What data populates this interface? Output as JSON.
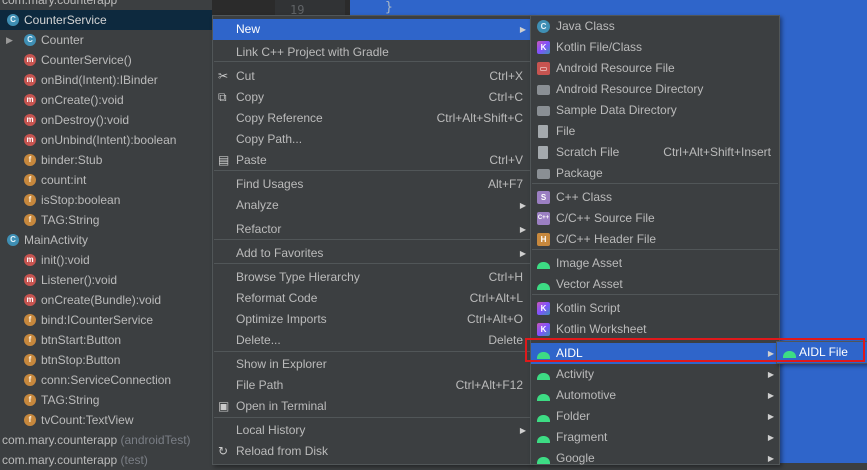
{
  "editor": {
    "line_number": "19",
    "brace": "}"
  },
  "tree": {
    "top_package": "com.mary.counterapp",
    "rows": [
      {
        "label": "CounterService",
        "icon": "class-icon",
        "kind": "c"
      },
      {
        "label": "Counter",
        "icon": "class-icon",
        "kind": "c"
      },
      {
        "label": "CounterService()",
        "icon": "method-icon",
        "kind": "m"
      },
      {
        "label": "onBind(Intent):IBinder",
        "icon": "method-icon",
        "kind": "m"
      },
      {
        "label": "onCreate():void",
        "icon": "method-icon",
        "kind": "m"
      },
      {
        "label": "onDestroy():void",
        "icon": "method-icon",
        "kind": "m"
      },
      {
        "label": "onUnbind(Intent):boolean",
        "icon": "method-icon",
        "kind": "m"
      },
      {
        "label": "binder:Stub",
        "icon": "field-icon",
        "kind": "f"
      },
      {
        "label": "count:int",
        "icon": "field-icon",
        "kind": "f"
      },
      {
        "label": "isStop:boolean",
        "icon": "field-icon",
        "kind": "f"
      },
      {
        "label": "TAG:String",
        "icon": "field-icon",
        "kind": "f"
      },
      {
        "label": "MainActivity",
        "icon": "class-icon",
        "kind": "c"
      },
      {
        "label": "init():void",
        "icon": "method-icon",
        "kind": "m"
      },
      {
        "label": "Listener():void",
        "icon": "method-icon",
        "kind": "m"
      },
      {
        "label": "onCreate(Bundle):void",
        "icon": "method-icon",
        "kind": "m"
      },
      {
        "label": "bind:ICounterService",
        "icon": "field-icon",
        "kind": "f"
      },
      {
        "label": "btnStart:Button",
        "icon": "field-icon",
        "kind": "f"
      },
      {
        "label": "btnStop:Button",
        "icon": "field-icon",
        "kind": "f"
      },
      {
        "label": "conn:ServiceConnection",
        "icon": "field-icon",
        "kind": "f"
      },
      {
        "label": "TAG:String",
        "icon": "field-icon",
        "kind": "f"
      },
      {
        "label": "tvCount:TextView",
        "icon": "field-icon",
        "kind": "f"
      }
    ],
    "bottom1_pkg": "com.mary.counterapp",
    "bottom1_suffix": "(androidTest)",
    "bottom2_pkg": "com.mary.counterapp",
    "bottom2_suffix": "(test)"
  },
  "menu": {
    "items": [
      {
        "label": "New",
        "shortcut": "",
        "submenu": true
      },
      {
        "label": "Link C++ Project with Gradle",
        "shortcut": ""
      },
      {
        "label": "Cut",
        "shortcut": "Ctrl+X",
        "icon": "scissors-icon"
      },
      {
        "label": "Copy",
        "shortcut": "Ctrl+C",
        "icon": "copy-icon"
      },
      {
        "label": "Copy Reference",
        "shortcut": "Ctrl+Alt+Shift+C"
      },
      {
        "label": "Copy Path...",
        "shortcut": ""
      },
      {
        "label": "Paste",
        "shortcut": "Ctrl+V",
        "icon": "paste-icon"
      },
      {
        "label": "Find Usages",
        "shortcut": "Alt+F7"
      },
      {
        "label": "Analyze",
        "shortcut": "",
        "submenu": true
      },
      {
        "label": "Refactor",
        "shortcut": "",
        "submenu": true
      },
      {
        "label": "Add to Favorites",
        "shortcut": "",
        "submenu": true
      },
      {
        "label": "Browse Type Hierarchy",
        "shortcut": "Ctrl+H"
      },
      {
        "label": "Reformat Code",
        "shortcut": "Ctrl+Alt+L"
      },
      {
        "label": "Optimize Imports",
        "shortcut": "Ctrl+Alt+O"
      },
      {
        "label": "Delete...",
        "shortcut": "Delete"
      },
      {
        "label": "Show in Explorer",
        "shortcut": ""
      },
      {
        "label": "File Path",
        "shortcut": "Ctrl+Alt+F12"
      },
      {
        "label": "Open in Terminal",
        "shortcut": "",
        "icon": "terminal-icon"
      },
      {
        "label": "Local History",
        "shortcut": "",
        "submenu": true
      },
      {
        "label": "Reload from Disk",
        "shortcut": "",
        "icon": "reload-icon"
      }
    ]
  },
  "new_menu": {
    "items": [
      {
        "label": "Java Class",
        "shortcut": ""
      },
      {
        "label": "Kotlin File/Class",
        "shortcut": ""
      },
      {
        "label": "Android Resource File",
        "shortcut": ""
      },
      {
        "label": "Android Resource Directory",
        "shortcut": ""
      },
      {
        "label": "Sample Data Directory",
        "shortcut": ""
      },
      {
        "label": "File",
        "shortcut": ""
      },
      {
        "label": "Scratch File",
        "shortcut": "Ctrl+Alt+Shift+Insert"
      },
      {
        "label": "Package",
        "shortcut": ""
      },
      {
        "label": "C++ Class",
        "shortcut": ""
      },
      {
        "label": "C/C++ Source File",
        "shortcut": ""
      },
      {
        "label": "C/C++ Header File",
        "shortcut": ""
      },
      {
        "label": "Image Asset",
        "shortcut": ""
      },
      {
        "label": "Vector Asset",
        "shortcut": ""
      },
      {
        "label": "Kotlin Script",
        "shortcut": ""
      },
      {
        "label": "Kotlin Worksheet",
        "shortcut": ""
      },
      {
        "label": "AIDL",
        "shortcut": "",
        "submenu": true
      },
      {
        "label": "Activity",
        "shortcut": "",
        "submenu": true
      },
      {
        "label": "Automotive",
        "shortcut": "",
        "submenu": true
      },
      {
        "label": "Folder",
        "shortcut": "",
        "submenu": true
      },
      {
        "label": "Fragment",
        "shortcut": "",
        "submenu": true
      },
      {
        "label": "Google",
        "shortcut": "",
        "submenu": true
      }
    ]
  },
  "aidl_menu": {
    "item": "AIDL File"
  },
  "colors": {
    "accent": "#2f65ca",
    "highlight_border": "#e0191b",
    "android_green": "#3ddc84"
  }
}
